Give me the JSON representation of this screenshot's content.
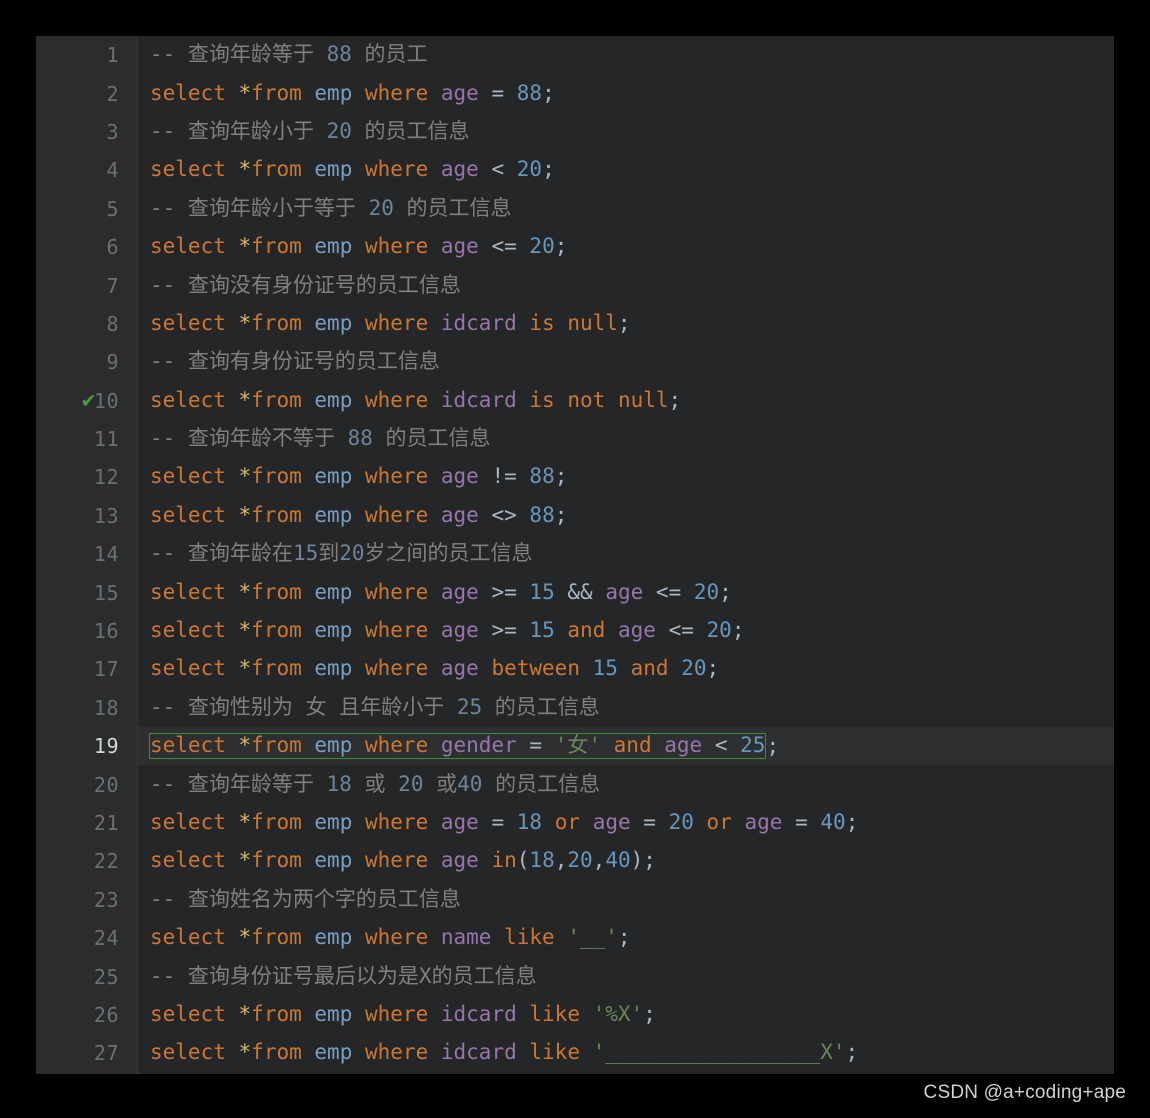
{
  "editor": {
    "theme_background": "#242627",
    "gutter_background": "#2a2c2d",
    "current_line_number": 19,
    "marker_line": 10,
    "marker_icon": "green-check-icon",
    "marker_glyph": "✔",
    "colors": {
      "keyword": "#cc7832",
      "asterisk": "#d9bb6b",
      "table": "#7a9ec2",
      "column": "#9876aa",
      "number": "#6897bb",
      "operator": "#a9b7c6",
      "string": "#6a8759",
      "comment": "#808080",
      "selection_border": "#3a8f35",
      "line_number": "#6d7072",
      "current_line_number": "#d4d7d9"
    },
    "lines": [
      {
        "n": "1",
        "type": "comment",
        "text": "-- 查询年龄等于 88 的员工"
      },
      {
        "n": "2",
        "type": "code",
        "text": "select *from emp where age = 88;"
      },
      {
        "n": "3",
        "type": "comment",
        "text": "-- 查询年龄小于 20 的员工信息"
      },
      {
        "n": "4",
        "type": "code",
        "text": "select *from emp where age < 20;"
      },
      {
        "n": "5",
        "type": "comment",
        "text": "-- 查询年龄小于等于 20 的员工信息"
      },
      {
        "n": "6",
        "type": "code",
        "text": "select *from emp where age <= 20;"
      },
      {
        "n": "7",
        "type": "comment",
        "text": "-- 查询没有身份证号的员工信息"
      },
      {
        "n": "8",
        "type": "code",
        "text": "select *from emp where idcard is null;"
      },
      {
        "n": "9",
        "type": "comment",
        "text": "-- 查询有身份证号的员工信息"
      },
      {
        "n": "10",
        "type": "code",
        "text": "select *from emp where idcard is not null;",
        "marker": true
      },
      {
        "n": "11",
        "type": "comment",
        "text": "-- 查询年龄不等于 88 的员工信息"
      },
      {
        "n": "12",
        "type": "code",
        "text": "select *from emp where age != 88;"
      },
      {
        "n": "13",
        "type": "code",
        "text": "select *from emp where age <> 88;"
      },
      {
        "n": "14",
        "type": "comment",
        "text": "-- 查询年龄在15到20岁之间的员工信息"
      },
      {
        "n": "15",
        "type": "code",
        "text": "select *from emp where age >= 15 && age <= 20;"
      },
      {
        "n": "16",
        "type": "code",
        "text": "select *from emp where age >= 15 and age <= 20;"
      },
      {
        "n": "17",
        "type": "code",
        "text": "select *from emp where age between 15 and 20;"
      },
      {
        "n": "18",
        "type": "comment",
        "text": "-- 查询性别为 女 且年龄小于 25 的员工信息"
      },
      {
        "n": "19",
        "type": "code",
        "text": "select *from emp where gender = '女' and age < 25;",
        "current": true
      },
      {
        "n": "20",
        "type": "comment",
        "text": "-- 查询年龄等于 18 或 20 或40 的员工信息"
      },
      {
        "n": "21",
        "type": "code",
        "text": "select *from emp where age = 18 or age = 20 or age = 40;"
      },
      {
        "n": "22",
        "type": "code",
        "text": "select *from emp where age in(18,20,40);"
      },
      {
        "n": "23",
        "type": "comment",
        "text": "-- 查询姓名为两个字的员工信息"
      },
      {
        "n": "24",
        "type": "code",
        "text": "select *from emp where name like '__';"
      },
      {
        "n": "25",
        "type": "comment",
        "text": "-- 查询身份证号最后以为是X的员工信息"
      },
      {
        "n": "26",
        "type": "code",
        "text": "select *from emp where idcard like '%X';"
      },
      {
        "n": "27",
        "type": "code",
        "text": "select *from emp where idcard like '_________________X';"
      }
    ]
  },
  "watermark": {
    "text": "CSDN @a+coding+ape"
  }
}
